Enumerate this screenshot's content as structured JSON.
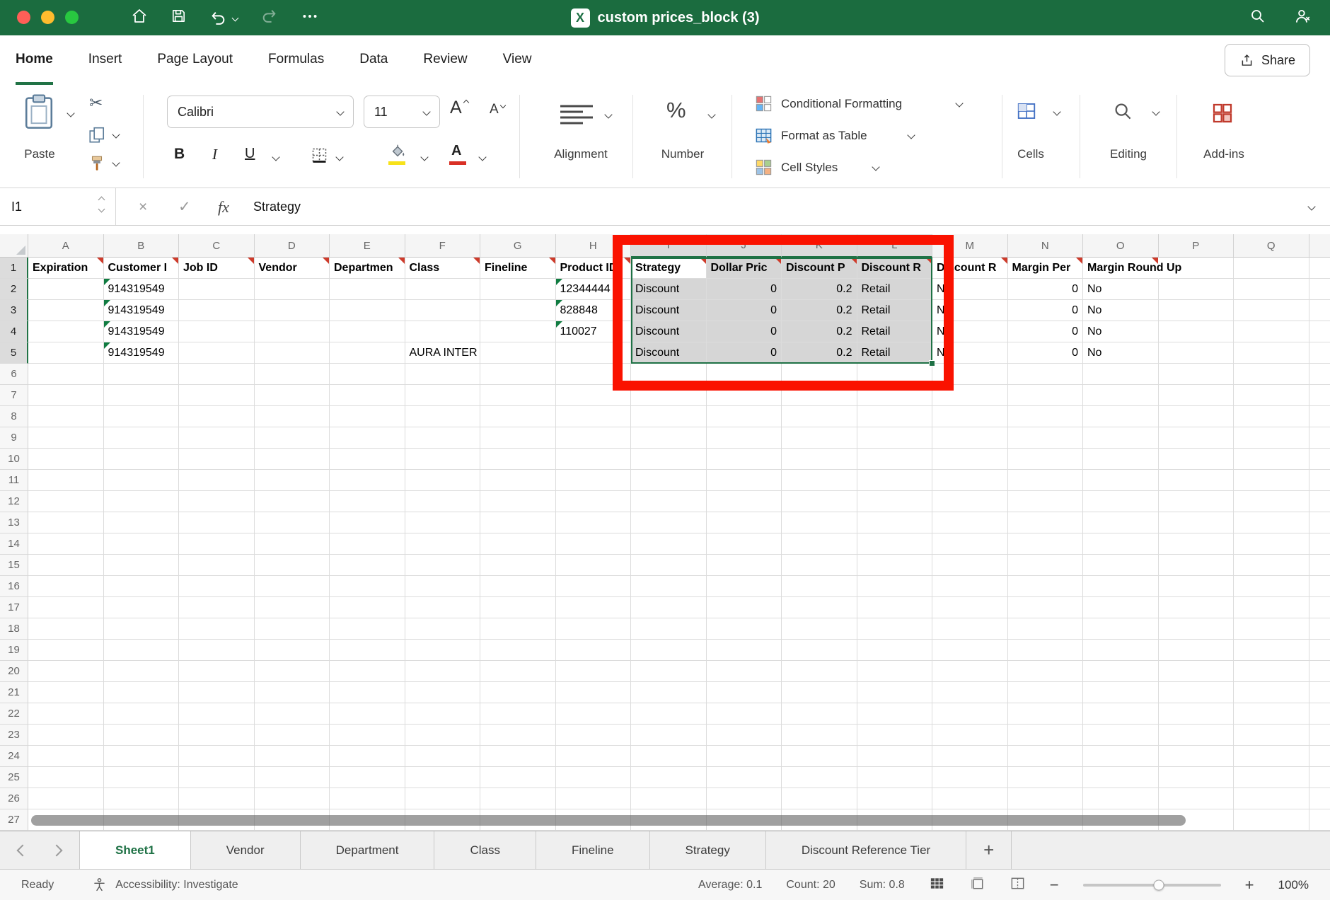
{
  "colors": {
    "brand_green": "#217346",
    "titlebar_green": "#1B6C3F",
    "annotation_red": "#FA1200",
    "selection_fill": "#D6D6D6",
    "flag_red": "#CE3B2B",
    "flag_green": "#107C41"
  },
  "titlebar": {
    "title": "custom prices_block (3)"
  },
  "icons": {
    "cut": "✂"
  },
  "ribbon_tabs": {
    "tabs": [
      "Home",
      "Insert",
      "Page Layout",
      "Formulas",
      "Data",
      "Review",
      "View"
    ],
    "active": "Home"
  },
  "ribbon": {
    "share": "Share",
    "paste": "Paste",
    "font_name": "Calibri",
    "font_size": "11",
    "bold": "B",
    "italic": "I",
    "underline": "U",
    "grow": "A",
    "shrink": "A",
    "font_color": "A",
    "percent": "%",
    "alignment": "Alignment",
    "number": "Number",
    "conditional_formatting": "Conditional Formatting",
    "format_as_table": "Format as Table",
    "cell_styles": "Cell Styles",
    "cells": "Cells",
    "editing": "Editing",
    "addins": "Add-ins"
  },
  "formula_bar": {
    "name_box": "I1",
    "fx_label": "fx",
    "value": "Strategy"
  },
  "grid": {
    "col_letters": [
      "A",
      "B",
      "C",
      "D",
      "E",
      "F",
      "G",
      "H",
      "I",
      "J",
      "K",
      "L",
      "M",
      "N",
      "O",
      "P",
      "Q"
    ],
    "row_count": 27,
    "selection": {
      "cols": [
        "I",
        "J",
        "K",
        "L"
      ],
      "row_start": 1,
      "row_end": 5,
      "active_col": "I",
      "active_row": 1
    },
    "cells": {
      "1": {
        "A": {
          "v": "Expiration",
          "fr": 1
        },
        "B": {
          "v": "Customer I",
          "fr": 1
        },
        "C": {
          "v": "Job ID",
          "fr": 1
        },
        "D": {
          "v": "Vendor",
          "fr": 1
        },
        "E": {
          "v": "Departmen",
          "fr": 1
        },
        "F": {
          "v": "Class",
          "fr": 1
        },
        "G": {
          "v": "Fineline",
          "fr": 1
        },
        "H": {
          "v": "Product ID",
          "fr": 1
        },
        "I": {
          "v": "Strategy",
          "fr": 1
        },
        "J": {
          "v": "Dollar Pric",
          "fr": 1
        },
        "K": {
          "v": "Discount P",
          "fr": 1
        },
        "L": {
          "v": "Discount R",
          "fr": 1
        },
        "M": {
          "v": "Discount R",
          "fr": 1
        },
        "N": {
          "v": "Margin Per",
          "fr": 1
        },
        "O": {
          "v": "Margin Round Up",
          "fr": 1,
          "o": 1
        }
      },
      "2": {
        "B": {
          "v": "914319549",
          "fg": 1
        },
        "H": {
          "v": "12344444",
          "fg": 1
        },
        "I": {
          "v": "Discount"
        },
        "J": {
          "v": "0",
          "r": 1
        },
        "K": {
          "v": "0.2",
          "r": 1
        },
        "L": {
          "v": "Retail"
        },
        "M": {
          "v": "No"
        },
        "N": {
          "v": "0",
          "r": 1
        },
        "O": {
          "v": "No"
        }
      },
      "3": {
        "B": {
          "v": "914319549",
          "fg": 1
        },
        "H": {
          "v": "828848",
          "fg": 1
        },
        "I": {
          "v": "Discount"
        },
        "J": {
          "v": "0",
          "r": 1
        },
        "K": {
          "v": "0.2",
          "r": 1
        },
        "L": {
          "v": "Retail"
        },
        "M": {
          "v": "No"
        },
        "N": {
          "v": "0",
          "r": 1
        },
        "O": {
          "v": "No"
        }
      },
      "4": {
        "B": {
          "v": "914319549",
          "fg": 1
        },
        "H": {
          "v": "110027",
          "fg": 1
        },
        "I": {
          "v": "Discount"
        },
        "J": {
          "v": "0",
          "r": 1
        },
        "K": {
          "v": "0.2",
          "r": 1
        },
        "L": {
          "v": "Retail"
        },
        "M": {
          "v": "No"
        },
        "N": {
          "v": "0",
          "r": 1
        },
        "O": {
          "v": "No"
        }
      },
      "5": {
        "B": {
          "v": "914319549",
          "fg": 1
        },
        "F": {
          "v": "AURA INTER"
        },
        "I": {
          "v": "Discount"
        },
        "J": {
          "v": "0",
          "r": 1
        },
        "K": {
          "v": "0.2",
          "r": 1
        },
        "L": {
          "v": "Retail"
        },
        "M": {
          "v": "No"
        },
        "N": {
          "v": "0",
          "r": 1
        },
        "O": {
          "v": "No"
        }
      }
    }
  },
  "sheet_tabs": {
    "tabs": [
      "Sheet1",
      "Vendor",
      "Department",
      "Class",
      "Fineline",
      "Strategy",
      "Discount Reference Tier"
    ],
    "active": "Sheet1",
    "add_label": "+"
  },
  "status": {
    "ready": "Ready",
    "accessibility": "Accessibility: Investigate",
    "average": "Average: 0.1",
    "count": "Count: 20",
    "sum": "Sum: 0.8",
    "zoom": "100%"
  }
}
